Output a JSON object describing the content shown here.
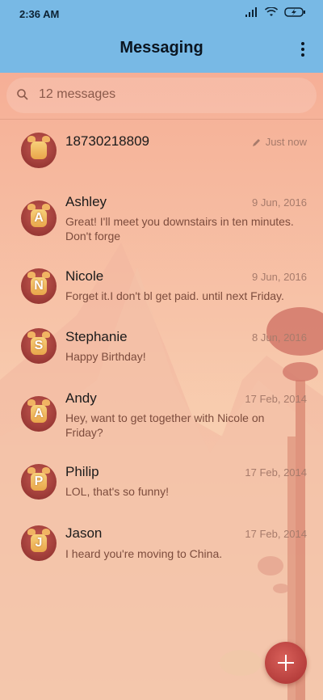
{
  "status_bar": {
    "time": "2:36 AM"
  },
  "header": {
    "title": "Messaging",
    "more_icon": "more-vert-icon"
  },
  "search": {
    "placeholder": "12 messages",
    "icon": "search-icon"
  },
  "conversations": [
    {
      "avatar_letter": "",
      "name": "18730218809",
      "date": "Just now",
      "preview": "",
      "draft": true
    },
    {
      "avatar_letter": "A",
      "name": "Ashley",
      "date": "9 Jun, 2016",
      "preview": "Great! I'll meet you downstairs in ten minutes. Don't forge"
    },
    {
      "avatar_letter": "N",
      "name": "Nicole",
      "date": "9 Jun, 2016",
      "preview": "Forget it.I don't bl get paid. until next Friday."
    },
    {
      "avatar_letter": "S",
      "name": "Stephanie",
      "date": "8 Jun, 2016",
      "preview": "Happy Birthday!"
    },
    {
      "avatar_letter": "A",
      "name": "Andy",
      "date": "17 Feb, 2014",
      "preview": "Hey, want to get together with Nicole on Friday?"
    },
    {
      "avatar_letter": "P",
      "name": "Philip",
      "date": "17 Feb, 2014",
      "preview": "LOL, that's so funny!"
    },
    {
      "avatar_letter": "J",
      "name": "Jason",
      "date": "17 Feb, 2014",
      "preview": "I heard you're moving to China."
    }
  ],
  "fab": {
    "icon": "plus-icon"
  },
  "colors": {
    "header_bg": "#78b9e5",
    "accent": "#b43c3a"
  }
}
